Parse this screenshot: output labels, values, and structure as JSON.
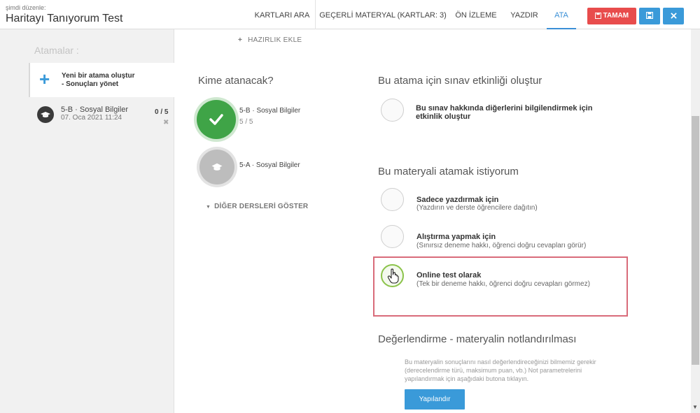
{
  "header": {
    "edit_label": "şimdi düzenle:",
    "title": "Haritayı Tanıyorum Test",
    "tabs": [
      {
        "label": "KARTLARI ARA"
      },
      {
        "label": "GEÇERLİ MATERYAL (KARTLAR: 3)"
      },
      {
        "label": "ÖN İZLEME"
      },
      {
        "label": "YAZDIR"
      },
      {
        "label": "ATA"
      }
    ],
    "active_tab": "ATA",
    "done_label": "TAMAM",
    "colors": {
      "accent": "#3a9ad9",
      "danger": "#e84c4c"
    }
  },
  "sidebar": {
    "heading": "Atamalar :",
    "new_assignment": {
      "line1": "Yeni bir atama oluştur",
      "line2": "- Sonuçları yönet"
    },
    "items": [
      {
        "name": "5-B · Sosyal Bilgiler",
        "date": "07. Oca 2021 11:24",
        "count": "0 / 5"
      }
    ]
  },
  "main": {
    "add_prep": "HAZIRLIK EKLE",
    "who_title": "Kime atanacak?",
    "classes": [
      {
        "name": "5-B · Sosyal Bilgiler",
        "count": "5 / 5",
        "selected": true
      },
      {
        "name": "5-A · Sosyal Bilgiler",
        "count": "",
        "selected": false
      }
    ],
    "show_more": "DİĞER DERSLERİ GÖSTER",
    "exam_title": "Bu atama için sınav etkinliği oluştur",
    "exam_option": {
      "line1": "Bu sınav hakkında diğerlerini bilgilendirmek için",
      "line2": "etkinlik oluştur"
    },
    "assign_title": "Bu materyali atamak istiyorum",
    "options": [
      {
        "title": "Sadece yazdırmak için",
        "sub": "(Yazdırın ve derste öğrencilere dağıtın)",
        "selected": false
      },
      {
        "title": "Alıştırma yapmak için",
        "sub": "(Sınırsız deneme hakkı, öğrenci doğru cevapları görür)",
        "selected": false
      },
      {
        "title": "Online test olarak",
        "sub": "(Tek bir deneme hakkı, öğrenci doğru cevapları görmez)",
        "selected": true
      }
    ],
    "eval_title": "Değerlendirme - materyalin notlandırılması",
    "eval_desc": "Bu materyalin sonuçlarını nasıl değerlendireceğinizi bilmemiz gerekir (derecelendirme türü, maksimum puan, vb.) Not parametrelerini yapılandırmak için aşağıdaki butona tıklayın.",
    "configure_label": "Yapılandır"
  }
}
